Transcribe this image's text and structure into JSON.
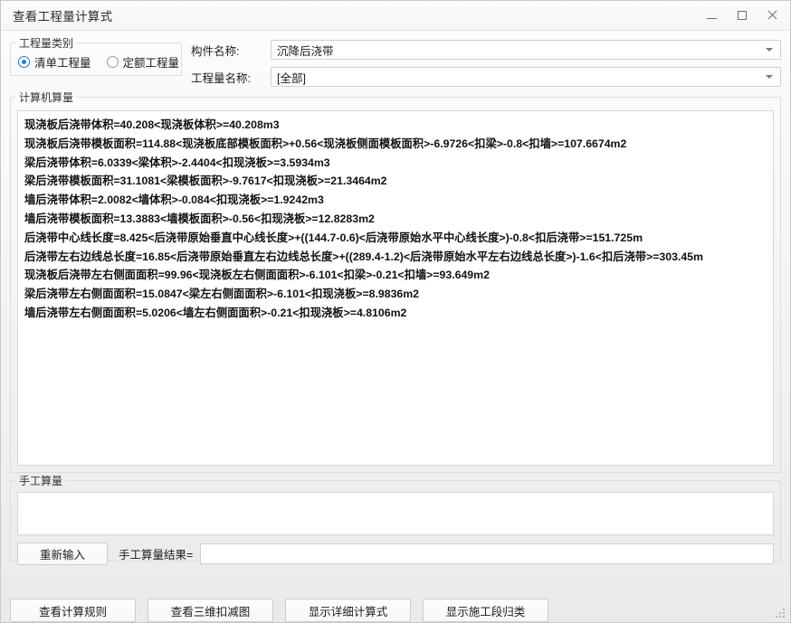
{
  "window": {
    "title": "查看工程量计算式",
    "controls": {
      "minimize": "最小化",
      "maximize": "最大化",
      "close": "关闭"
    }
  },
  "category_group": {
    "legend": "工程量类别",
    "options": [
      {
        "label": "清单工程量",
        "selected": true
      },
      {
        "label": "定额工程量",
        "selected": false
      }
    ]
  },
  "fields": {
    "component": {
      "label": "构件名称:",
      "value": "沉降后浇带"
    },
    "quantity": {
      "label": "工程量名称:",
      "value": "[全部]"
    }
  },
  "calc_group": {
    "legend": "计算机算量",
    "lines": [
      "现浇板后浇带体积=40.208<现浇板体积>=40.208m3",
      "现浇板后浇带模板面积=114.88<现浇板底部模板面积>+0.56<现浇板侧面模板面积>-6.9726<扣梁>-0.8<扣墙>=107.6674m2",
      "梁后浇带体积=6.0339<梁体积>-2.4404<扣现浇板>=3.5934m3",
      "梁后浇带模板面积=31.1081<梁模板面积>-9.7617<扣现浇板>=21.3464m2",
      "墙后浇带体积=2.0082<墙体积>-0.084<扣现浇板>=1.9242m3",
      "墙后浇带模板面积=13.3883<墙模板面积>-0.56<扣现浇板>=12.8283m2",
      "后浇带中心线长度=8.425<后浇带原始垂直中心线长度>+((144.7-0.6)<后浇带原始水平中心线长度>)-0.8<扣后浇带>=151.725m",
      "后浇带左右边线总长度=16.85<后浇带原始垂直左右边线总长度>+((289.4-1.2)<后浇带原始水平左右边线总长度>)-1.6<扣后浇带>=303.45m",
      "现浇板后浇带左右侧面面积=99.96<现浇板左右侧面面积>-6.101<扣梁>-0.21<扣墙>=93.649m2",
      "梁后浇带左右侧面面积=15.0847<梁左右侧面面积>-6.101<扣现浇板>=8.9836m2",
      "墙后浇带左右侧面面积=5.0206<墙左右侧面面积>-0.21<扣现浇板>=4.8106m2"
    ]
  },
  "manual_group": {
    "legend": "手工算量",
    "textarea_value": "",
    "reinput_button": "重新输入",
    "result_label": "手工算量结果=",
    "result_value": ""
  },
  "bottom_buttons": [
    "查看计算规则",
    "查看三维扣减图",
    "显示详细计算式",
    "显示施工段归类"
  ],
  "colors": {
    "accent": "#1a7ce0",
    "window_bg": "#f4f4f4",
    "field_bg": "#ffffff",
    "border": "#d6d6d6",
    "text": "#1a1a1a"
  }
}
